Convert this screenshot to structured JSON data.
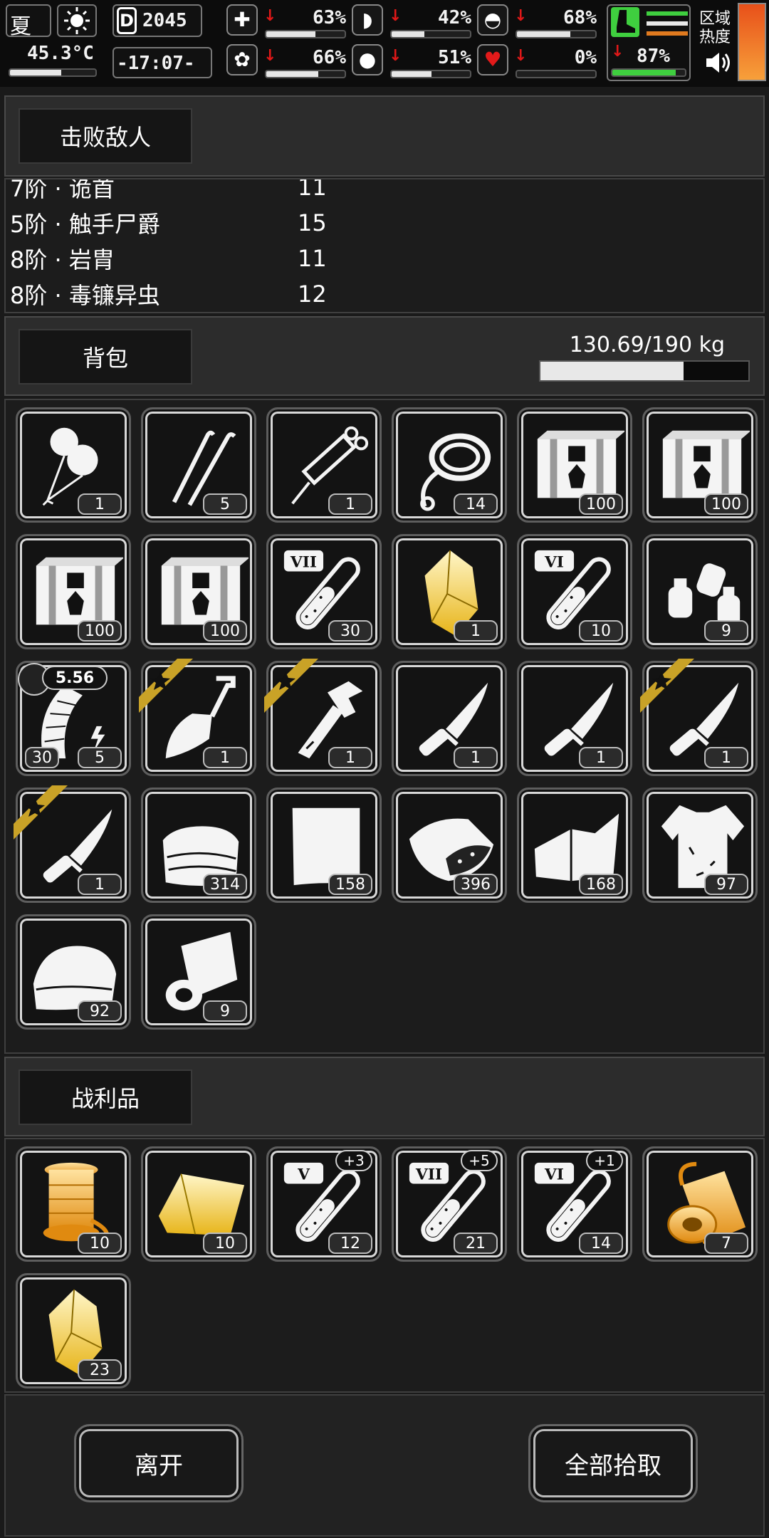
{
  "status": {
    "season": "夏",
    "temperature": "45.3°C",
    "day": "2045",
    "time": "-17:07-",
    "area_label": "区域热度",
    "stats": [
      {
        "name": "health",
        "icon": "medkit-icon",
        "value": "63%",
        "fill": 0.63
      },
      {
        "name": "hunger",
        "icon": "stomach-icon",
        "value": "42%",
        "fill": 0.42
      },
      {
        "name": "sanity",
        "icon": "helmet-icon",
        "value": "68%",
        "fill": 0.68
      },
      {
        "name": "mind",
        "icon": "brain-icon",
        "value": "66%",
        "fill": 0.66
      },
      {
        "name": "thirst",
        "icon": "water-drop-icon",
        "value": "51%",
        "fill": 0.51
      },
      {
        "name": "heart",
        "icon": "heart-icon",
        "value": "0%",
        "fill": 0.0
      }
    ],
    "stamina": {
      "value": "87%",
      "fill": 0.87
    }
  },
  "defeated": {
    "title": "击败敌人",
    "rows": [
      {
        "name": "7阶 · 诡首",
        "count": "11"
      },
      {
        "name": "5阶 · 触手尸爵",
        "count": "15"
      },
      {
        "name": "8阶 · 岩胄",
        "count": "11"
      },
      {
        "name": "8阶 · 毒镰异虫",
        "count": "12"
      }
    ]
  },
  "backpack": {
    "title": "背包",
    "weight": "130.69/190 kg",
    "weight_fill": 0.688,
    "items": [
      {
        "icon": "balloon-icon",
        "qty": "1"
      },
      {
        "icon": "lockpick-icon",
        "qty": "5"
      },
      {
        "icon": "syringe-icon",
        "qty": "1"
      },
      {
        "icon": "rope-icon",
        "qty": "14"
      },
      {
        "icon": "supply-crate-icon",
        "qty": "100"
      },
      {
        "icon": "supply-crate-icon",
        "qty": "100"
      },
      {
        "icon": "supply-crate-icon",
        "qty": "100"
      },
      {
        "icon": "supply-crate-icon",
        "qty": "100"
      },
      {
        "icon": "test-tube-icon",
        "qty": "30",
        "tier": "VII"
      },
      {
        "icon": "gold-crystal-icon",
        "qty": "1"
      },
      {
        "icon": "test-tube-icon",
        "qty": "10",
        "tier": "VI"
      },
      {
        "icon": "bottles-icon",
        "qty": "9"
      },
      {
        "icon": "ammo-magazine-icon",
        "qty": "5",
        "qty_left": "30",
        "caliber": "5.56"
      },
      {
        "icon": "shovel-icon",
        "qty": "1",
        "starred": true
      },
      {
        "icon": "multitool-icon",
        "qty": "1",
        "starred": true
      },
      {
        "icon": "knife-icon",
        "qty": "1"
      },
      {
        "icon": "knife-icon",
        "qty": "1"
      },
      {
        "icon": "knife-icon",
        "qty": "1",
        "starred": true
      },
      {
        "icon": "knife-icon",
        "qty": "1",
        "starred": true
      },
      {
        "icon": "cloth-icon",
        "qty": "314"
      },
      {
        "icon": "paper-icon",
        "qty": "158"
      },
      {
        "icon": "ore-icon",
        "qty": "396"
      },
      {
        "icon": "leather-icon",
        "qty": "168"
      },
      {
        "icon": "shirt-icon",
        "qty": "97"
      },
      {
        "icon": "fabric-icon",
        "qty": "92"
      },
      {
        "icon": "bandage-roll-icon",
        "qty": "9"
      }
    ]
  },
  "loot": {
    "title": "战利品",
    "items": [
      {
        "icon": "thread-spool-icon",
        "qty": "10"
      },
      {
        "icon": "gold-cloth-icon",
        "qty": "10"
      },
      {
        "icon": "test-tube-icon",
        "qty": "12",
        "tier": "V",
        "bonus": "+3"
      },
      {
        "icon": "test-tube-icon",
        "qty": "21",
        "tier": "VII",
        "bonus": "+5"
      },
      {
        "icon": "test-tube-icon",
        "qty": "14",
        "tier": "VI",
        "bonus": "+1"
      },
      {
        "icon": "gold-rope-icon",
        "qty": "7"
      },
      {
        "icon": "gold-crystal-icon",
        "qty": "23"
      }
    ]
  },
  "actions": {
    "leave": "离开",
    "take_all": "全部拾取"
  }
}
